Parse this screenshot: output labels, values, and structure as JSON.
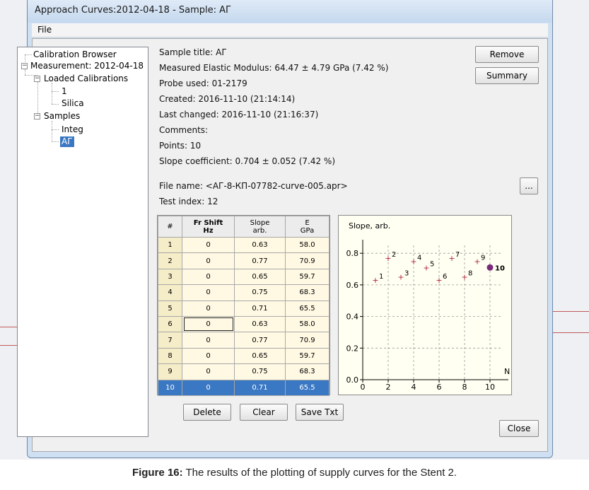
{
  "window": {
    "title": "Approach Curves:2012-04-18 - Sample: АГ"
  },
  "menu": {
    "file": "File"
  },
  "tree": {
    "calibration_browser": "Calibration Browser",
    "measurement": "Measurement: 2012-04-18",
    "loaded_calibrations": "Loaded Calibrations",
    "cal_1": "1",
    "cal_silica": "Silica",
    "samples": "Samples",
    "sample_integ": "Integ",
    "sample_ag": "АГ",
    "expand_glyph": "−"
  },
  "info": {
    "sample_title": "Sample title: АГ",
    "modulus": "Measured Elastic Modulus: 64.47 ± 4.79 GPa (7.42 %)",
    "probe": "Probe used: 01-2179",
    "created": "Created: 2016-11-10 (21:14:14)",
    "last_changed": "Last changed: 2016-11-10 (21:16:37)",
    "comments": "Comments:",
    "points": "Points: 10",
    "slope": "Slope coefficient: 0.704 ± 0.052 (7.42 %)",
    "file_name": "File name: <АГ-8-КП-07782-curve-005.apr>",
    "test_index": "Test index: 12"
  },
  "buttons": {
    "remove": "Remove",
    "summary": "Summary",
    "browse": "...",
    "delete": "Delete",
    "clear": "Clear",
    "save_txt": "Save Txt",
    "close": "Close"
  },
  "table": {
    "headers": [
      {
        "l1": "#",
        "l2": ""
      },
      {
        "l1": "Fr Shift",
        "l2": "Hz"
      },
      {
        "l1": "Slope",
        "l2": "arb."
      },
      {
        "l1": "E",
        "l2": "GPa"
      }
    ],
    "rows": [
      [
        "1",
        "0",
        "0.63",
        "58.0"
      ],
      [
        "2",
        "0",
        "0.77",
        "70.9"
      ],
      [
        "3",
        "0",
        "0.65",
        "59.7"
      ],
      [
        "4",
        "0",
        "0.75",
        "68.3"
      ],
      [
        "5",
        "0",
        "0.71",
        "65.5"
      ],
      [
        "6",
        "0",
        "0.63",
        "58.0"
      ],
      [
        "7",
        "0",
        "0.77",
        "70.9"
      ],
      [
        "8",
        "0",
        "0.65",
        "59.7"
      ],
      [
        "9",
        "0",
        "0.75",
        "68.3"
      ],
      [
        "10",
        "0",
        "0.71",
        "65.5"
      ]
    ],
    "selected_row": 10,
    "focused_cell": {
      "row": 6,
      "col": 1
    }
  },
  "chart_data": {
    "type": "scatter",
    "ylabel": "Slope, arb.",
    "xlabel": "N",
    "xlim": [
      0,
      11
    ],
    "ylim": [
      0,
      0.85
    ],
    "xticks": [
      0,
      2,
      4,
      6,
      8,
      10
    ],
    "yticks": [
      0.0,
      0.2,
      0.4,
      0.6,
      0.8
    ],
    "ytick_labels": [
      "0.0",
      "0.2",
      "0.4",
      "0.6",
      "0.8"
    ],
    "grid": true,
    "points": [
      {
        "label": "1",
        "x": 1,
        "y": 0.63
      },
      {
        "label": "2",
        "x": 2,
        "y": 0.77
      },
      {
        "label": "3",
        "x": 3,
        "y": 0.65
      },
      {
        "label": "4",
        "x": 4,
        "y": 0.75
      },
      {
        "label": "5",
        "x": 5,
        "y": 0.71
      },
      {
        "label": "6",
        "x": 6,
        "y": 0.63
      },
      {
        "label": "7",
        "x": 7,
        "y": 0.77
      },
      {
        "label": "8",
        "x": 8,
        "y": 0.65
      },
      {
        "label": "9",
        "x": 9,
        "y": 0.75
      },
      {
        "label": "10",
        "x": 10,
        "y": 0.71
      }
    ],
    "selected_point": 10,
    "colors": {
      "marker": "#b0203a",
      "selected": "#7a2a7a",
      "grid": "#9a9a9a"
    }
  },
  "caption": {
    "label": "Figure 16:",
    "text": " The results of the plotting of supply curves for the Stent 2."
  }
}
